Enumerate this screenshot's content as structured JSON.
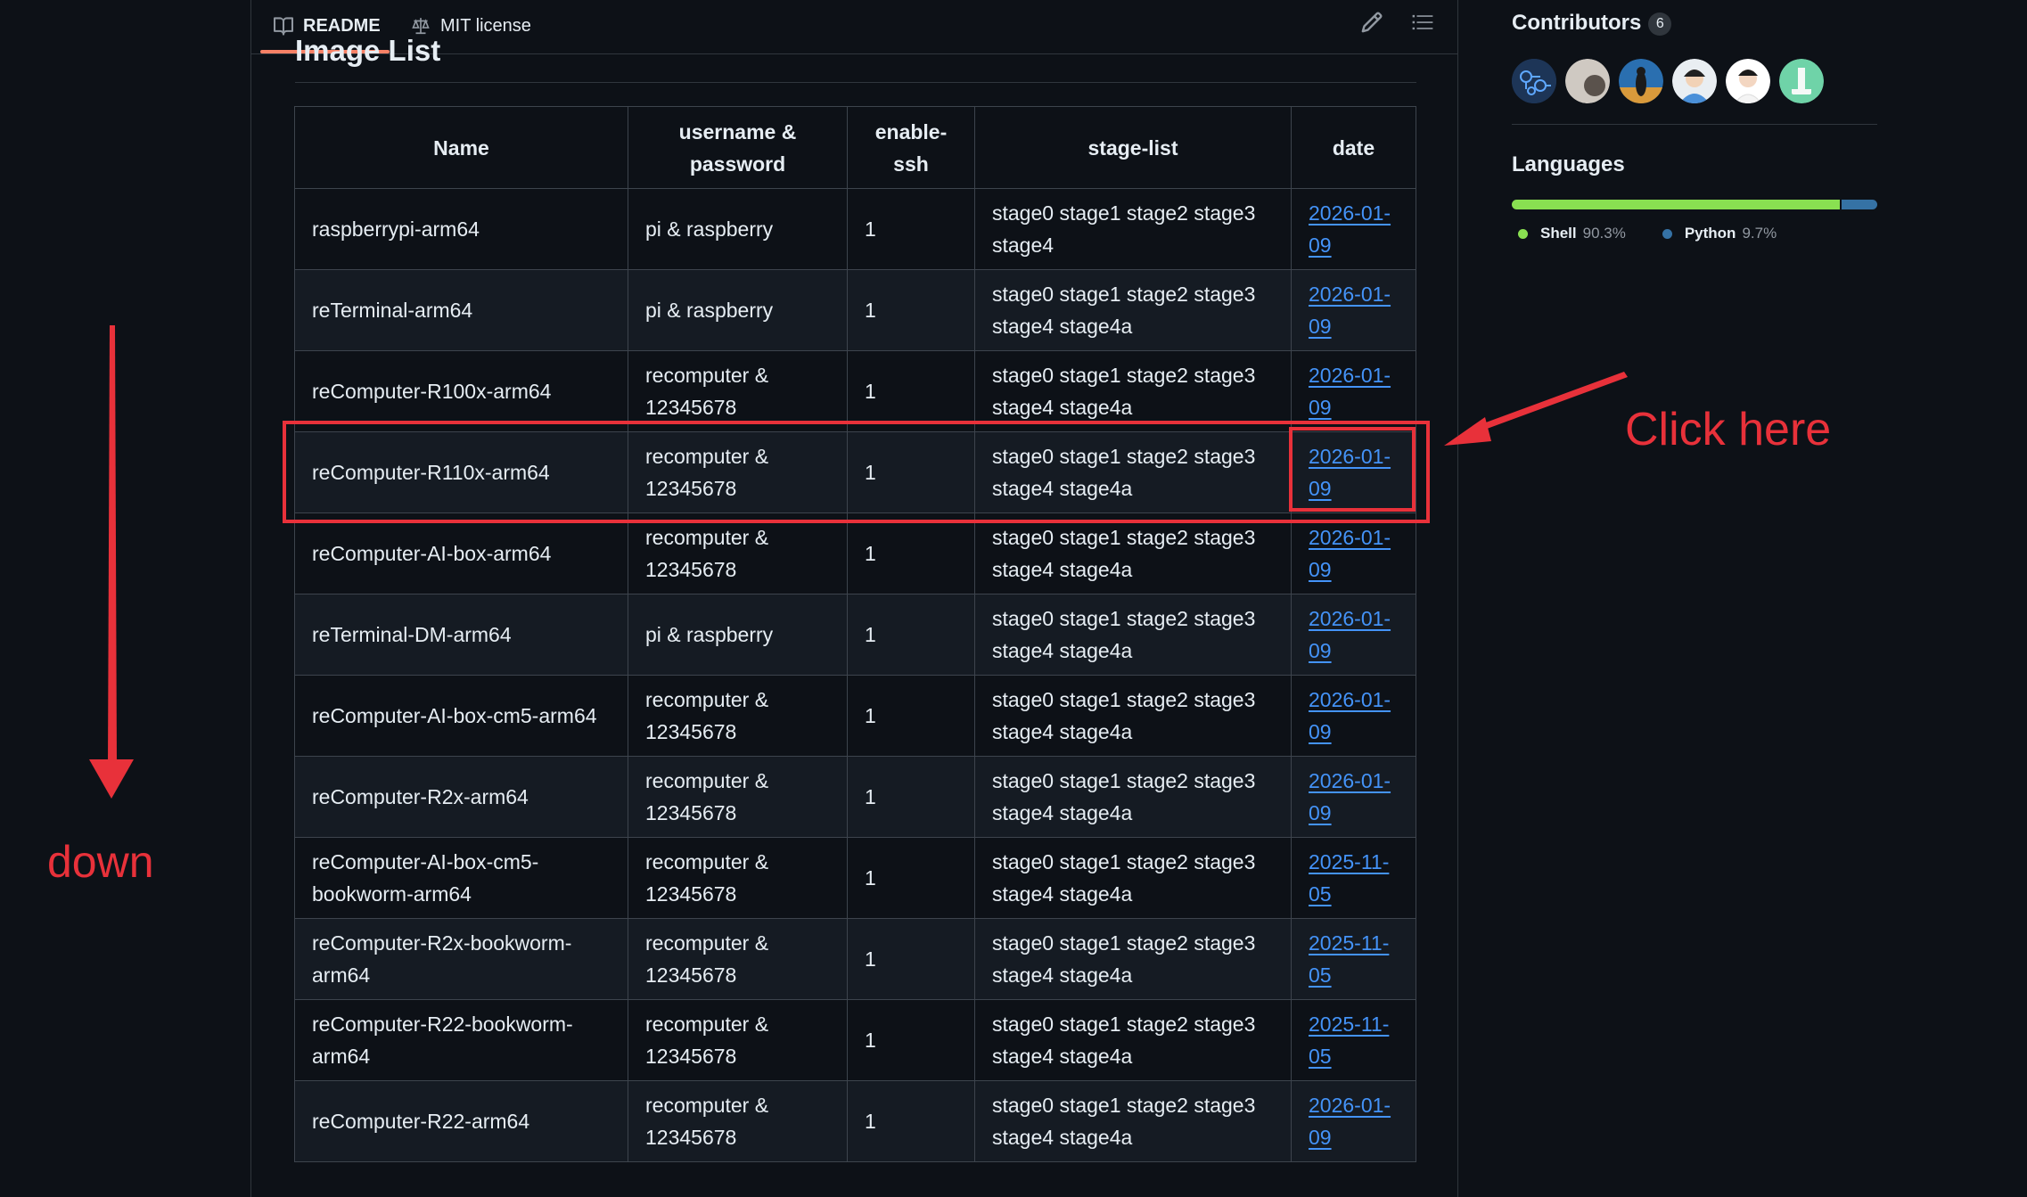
{
  "tabs": {
    "readme": "README",
    "license": "MIT license"
  },
  "heading": "Image List",
  "table": {
    "headers": [
      "Name",
      "username & password",
      "enable-ssh",
      "stage-list",
      "date"
    ],
    "rows": [
      {
        "name": "raspberrypi-arm64",
        "credentials": "pi & raspberry",
        "ssh": "1",
        "stages": "stage0 stage1 stage2 stage3 stage4",
        "date": "2026-01-09"
      },
      {
        "name": "reTerminal-arm64",
        "credentials": "pi & raspberry",
        "ssh": "1",
        "stages": "stage0 stage1 stage2 stage3 stage4 stage4a",
        "date": "2026-01-09"
      },
      {
        "name": "reComputer-R100x-arm64",
        "credentials": "recomputer & 12345678",
        "ssh": "1",
        "stages": "stage0 stage1 stage2 stage3 stage4 stage4a",
        "date": "2026-01-09"
      },
      {
        "name": "reComputer-R110x-arm64",
        "credentials": "recomputer & 12345678",
        "ssh": "1",
        "stages": "stage0 stage1 stage2 stage3 stage4 stage4a",
        "date": "2026-01-09"
      },
      {
        "name": "reComputer-AI-box-arm64",
        "credentials": "recomputer & 12345678",
        "ssh": "1",
        "stages": "stage0 stage1 stage2 stage3 stage4 stage4a",
        "date": "2026-01-09"
      },
      {
        "name": "reTerminal-DM-arm64",
        "credentials": "pi & raspberry",
        "ssh": "1",
        "stages": "stage0 stage1 stage2 stage3 stage4 stage4a",
        "date": "2026-01-09"
      },
      {
        "name": "reComputer-AI-box-cm5-arm64",
        "credentials": "recomputer & 12345678",
        "ssh": "1",
        "stages": "stage0 stage1 stage2 stage3 stage4 stage4a",
        "date": "2026-01-09"
      },
      {
        "name": "reComputer-R2x-arm64",
        "credentials": "recomputer & 12345678",
        "ssh": "1",
        "stages": "stage0 stage1 stage2 stage3 stage4 stage4a",
        "date": "2026-01-09"
      },
      {
        "name": "reComputer-AI-box-cm5-bookworm-arm64",
        "credentials": "recomputer & 12345678",
        "ssh": "1",
        "stages": "stage0 stage1 stage2 stage3 stage4 stage4a",
        "date": "2025-11-05"
      },
      {
        "name": "reComputer-R2x-bookworm-arm64",
        "credentials": "recomputer & 12345678",
        "ssh": "1",
        "stages": "stage0 stage1 stage2 stage3 stage4 stage4a",
        "date": "2025-11-05"
      },
      {
        "name": "reComputer-R22-bookworm-arm64",
        "credentials": "recomputer & 12345678",
        "ssh": "1",
        "stages": "stage0 stage1 stage2 stage3 stage4 stage4a",
        "date": "2025-11-05"
      },
      {
        "name": "reComputer-R22-arm64",
        "credentials": "recomputer & 12345678",
        "ssh": "1",
        "stages": "stage0 stage1 stage2 stage3 stage4 stage4a",
        "date": "2026-01-09"
      }
    ]
  },
  "annotations": {
    "click_text": "Click here",
    "down_text": "down",
    "color": "#e8313a"
  },
  "sidebar": {
    "contributors_title": "Contributors",
    "contributors_count": "6",
    "languages_title": "Languages",
    "languages": [
      {
        "name": "Shell",
        "percent": "90.3%",
        "share": 90.3,
        "color": "#89e051"
      },
      {
        "name": "Python",
        "percent": "9.7%",
        "share": 9.7,
        "color": "#3572a5"
      }
    ]
  },
  "icons": {
    "readme_tab": "book-icon",
    "license_tab": "law-scale-icon",
    "edit": "pencil-icon",
    "outline": "list-icon"
  }
}
